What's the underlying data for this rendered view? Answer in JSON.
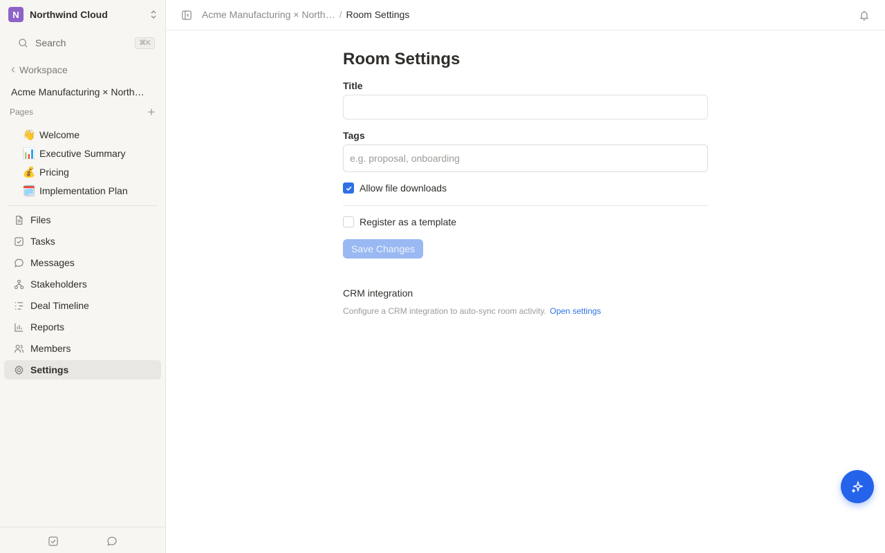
{
  "workspace": {
    "logo_letter": "N",
    "name": "Northwind Cloud"
  },
  "search": {
    "label": "Search",
    "shortcut": "⌘K"
  },
  "sidebar": {
    "back_label": "Workspace",
    "room_name": "Acme Manufacturing × North…",
    "pages_label": "Pages",
    "pages": [
      {
        "emoji": "👋",
        "label": "Welcome"
      },
      {
        "emoji": "📊",
        "label": "Executive Summary"
      },
      {
        "emoji": "💰",
        "label": "Pricing"
      },
      {
        "emoji": "🗓️",
        "label": "Implementation Plan"
      }
    ],
    "nav": [
      {
        "icon": "file-icon",
        "label": "Files"
      },
      {
        "icon": "task-icon",
        "label": "Tasks"
      },
      {
        "icon": "message-icon",
        "label": "Messages"
      },
      {
        "icon": "stakeholders-icon",
        "label": "Stakeholders"
      },
      {
        "icon": "timeline-icon",
        "label": "Deal Timeline"
      },
      {
        "icon": "reports-icon",
        "label": "Reports"
      },
      {
        "icon": "members-icon",
        "label": "Members"
      },
      {
        "icon": "gear-icon",
        "label": "Settings",
        "active": true
      }
    ]
  },
  "breadcrumb": {
    "room": "Acme Manufacturing × North…",
    "separator": "/",
    "current": "Room Settings"
  },
  "main": {
    "title": "Room Settings",
    "title_field": {
      "label": "Title",
      "value": ""
    },
    "tags_field": {
      "label": "Tags",
      "placeholder": "e.g. proposal, onboarding"
    },
    "allow_downloads": {
      "label": "Allow file downloads",
      "checked": true
    },
    "register_template": {
      "label": "Register as a template",
      "checked": false
    },
    "save_label": "Save Changes",
    "crm": {
      "heading": "CRM integration",
      "description": "Configure a CRM integration to auto-sync room activity.",
      "link": "Open settings"
    }
  },
  "colors": {
    "accent": "#2f6fe4",
    "fab": "#2563eb",
    "workspace_logo": "#8e63c7",
    "sidebar_bg": "#f7f6f3"
  }
}
